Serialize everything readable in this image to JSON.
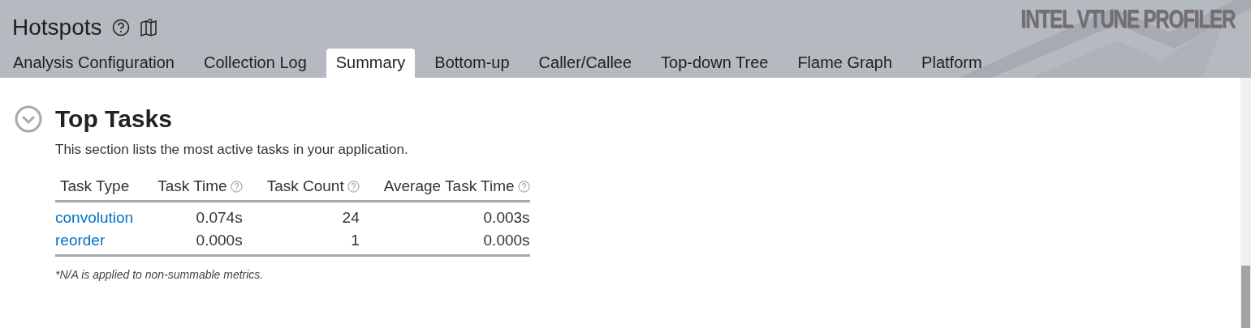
{
  "header": {
    "title": "Hotspots",
    "logo": "INTEL VTUNE PROFILER"
  },
  "tabs": [
    {
      "label": "Analysis Configuration",
      "selected": false
    },
    {
      "label": "Collection Log",
      "selected": false
    },
    {
      "label": "Summary",
      "selected": true
    },
    {
      "label": "Bottom-up",
      "selected": false
    },
    {
      "label": "Caller/Callee",
      "selected": false
    },
    {
      "label": "Top-down Tree",
      "selected": false
    },
    {
      "label": "Flame Graph",
      "selected": false
    },
    {
      "label": "Platform",
      "selected": false
    }
  ],
  "section": {
    "title": "Top Tasks",
    "expanded": true,
    "description": "This section lists the most active tasks in your application.",
    "table": {
      "columns": [
        {
          "label": "Task Type",
          "help": false
        },
        {
          "label": "Task Time",
          "help": true
        },
        {
          "label": "Task Count",
          "help": true
        },
        {
          "label": "Average Task Time",
          "help": true
        }
      ],
      "rows": [
        [
          "convolution",
          "0.074s",
          "24",
          "0.003s"
        ],
        [
          "reorder",
          "0.000s",
          "1",
          "0.000s"
        ]
      ]
    },
    "footnote": "*N/A is applied to non-summable metrics."
  }
}
